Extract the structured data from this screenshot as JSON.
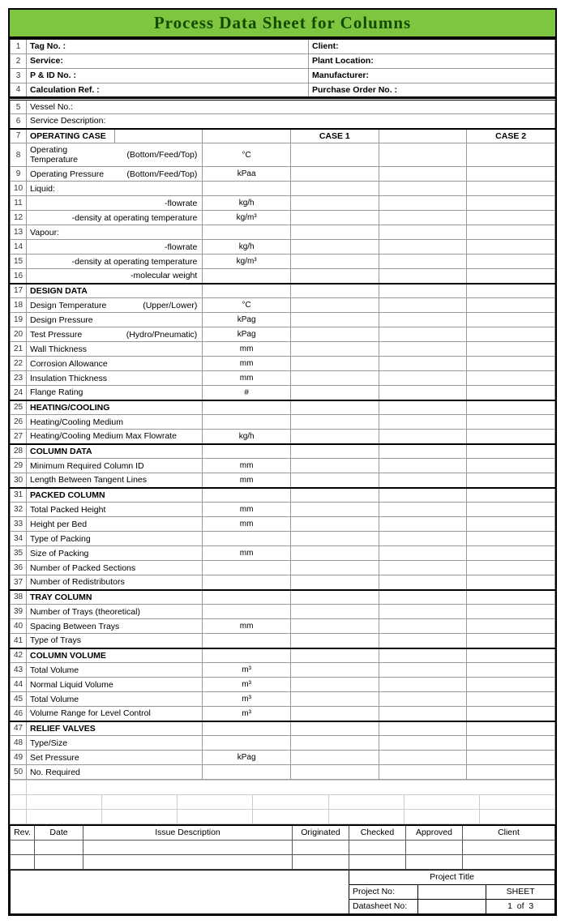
{
  "title": "Process Data Sheet for Columns",
  "header": [
    {
      "n": "1",
      "l": "Tag No. :",
      "r": "Client:"
    },
    {
      "n": "2",
      "l": "Service:",
      "r": "Plant Location:"
    },
    {
      "n": "3",
      "l": "P & ID No. :",
      "r": "Manufacturer:"
    },
    {
      "n": "4",
      "l": "Calculation Ref. :",
      "r": "Purchase Order No. :"
    }
  ],
  "intro": [
    {
      "n": "5",
      "l": "Vessel No.:"
    },
    {
      "n": "6",
      "l": "Service Description:"
    }
  ],
  "opcase": {
    "n": "7",
    "l": "OPERATING CASE",
    "c1": "CASE 1",
    "c2": "CASE 2"
  },
  "rows": [
    {
      "n": "8",
      "l": "Operating Temperature",
      "m": "(Bottom/Feed/Top)",
      "u": "°C"
    },
    {
      "n": "9",
      "l": "Operating Pressure",
      "m": "(Bottom/Feed/Top)",
      "u": "kPaa"
    },
    {
      "n": "10",
      "l": "Liquid:",
      "m": "",
      "u": ""
    },
    {
      "n": "11",
      "l": "",
      "m": "-flowrate",
      "u": "kg/h"
    },
    {
      "n": "12",
      "l": "",
      "m": "-density at operating temperature",
      "u": "kg/m³"
    },
    {
      "n": "13",
      "l": "Vapour:",
      "m": "",
      "u": ""
    },
    {
      "n": "14",
      "l": "",
      "m": "-flowrate",
      "u": "kg/h"
    },
    {
      "n": "15",
      "l": "",
      "m": "-density at operating temperature",
      "u": "kg/m³"
    },
    {
      "n": "16",
      "l": "",
      "m": "-molecular weight",
      "u": ""
    },
    {
      "n": "17",
      "l": "DESIGN DATA",
      "sec": true
    },
    {
      "n": "18",
      "l": "Design Temperature",
      "m": "(Upper/Lower)",
      "u": "°C"
    },
    {
      "n": "19",
      "l": "Design Pressure",
      "m": "",
      "u": "kPag"
    },
    {
      "n": "20",
      "l": "Test Pressure",
      "m": "(Hydro/Pneumatic)",
      "u": "kPag"
    },
    {
      "n": "21",
      "l": "Wall Thickness",
      "m": "",
      "u": "mm"
    },
    {
      "n": "22",
      "l": "Corrosion Allowance",
      "m": "",
      "u": "mm"
    },
    {
      "n": "23",
      "l": "Insulation Thickness",
      "m": "",
      "u": "mm"
    },
    {
      "n": "24",
      "l": "Flange Rating",
      "m": "",
      "u": "#"
    },
    {
      "n": "25",
      "l": "HEATING/COOLING",
      "sec": true
    },
    {
      "n": "26",
      "l": "Heating/Cooling Medium",
      "m": "",
      "u": ""
    },
    {
      "n": "27",
      "l": "Heating/Cooling Medium Max Flowrate",
      "m": "",
      "u": "kg/h"
    },
    {
      "n": "28",
      "l": "COLUMN DATA",
      "sec": true
    },
    {
      "n": "29",
      "l": "Minimum Required Column ID",
      "m": "",
      "u": "mm"
    },
    {
      "n": "30",
      "l": "Length Between Tangent Lines",
      "m": "",
      "u": "mm"
    },
    {
      "n": "31",
      "l": "PACKED COLUMN",
      "sec": true
    },
    {
      "n": "32",
      "l": "Total Packed Height",
      "m": "",
      "u": "mm"
    },
    {
      "n": "33",
      "l": "Height per Bed",
      "m": "",
      "u": "mm"
    },
    {
      "n": "34",
      "l": "Type of Packing",
      "m": "",
      "u": ""
    },
    {
      "n": "35",
      "l": "Size of Packing",
      "m": "",
      "u": "mm"
    },
    {
      "n": "36",
      "l": "Number of Packed Sections",
      "m": "",
      "u": ""
    },
    {
      "n": "37",
      "l": "Number of Redistributors",
      "m": "",
      "u": ""
    },
    {
      "n": "38",
      "l": "TRAY COLUMN",
      "sec": true
    },
    {
      "n": "39",
      "l": "Number of Trays (theoretical)",
      "m": "",
      "u": ""
    },
    {
      "n": "40",
      "l": "Spacing Between Trays",
      "m": "",
      "u": "mm"
    },
    {
      "n": "41",
      "l": "Type of Trays",
      "m": "",
      "u": ""
    },
    {
      "n": "42",
      "l": "COLUMN VOLUME",
      "sec": true
    },
    {
      "n": "43",
      "l": "Total Volume",
      "m": "",
      "u": "m³"
    },
    {
      "n": "44",
      "l": "Normal Liquid Volume",
      "m": "",
      "u": "m³"
    },
    {
      "n": "45",
      "l": "Total Volume",
      "m": "",
      "u": "m³"
    },
    {
      "n": "46",
      "l": "Volume Range for Level Control",
      "m": "",
      "u": "m³"
    },
    {
      "n": "47",
      "l": "RELIEF VALVES",
      "sec": true
    },
    {
      "n": "48",
      "l": "Type/Size",
      "m": "",
      "u": ""
    },
    {
      "n": "49",
      "l": "Set Pressure",
      "m": "",
      "u": "kPag"
    },
    {
      "n": "50",
      "l": "No. Required",
      "m": "",
      "u": ""
    }
  ],
  "rev": {
    "rev": "Rev.",
    "date": "Date",
    "desc": "Issue Description",
    "orig": "Originated",
    "chk": "Checked",
    "app": "Approved",
    "cli": "Client"
  },
  "footer": {
    "pt": "Project Title",
    "pn": "Project No:",
    "ds": "Datasheet No:",
    "sheet": "SHEET",
    "page": "1",
    "of": "of",
    "tot": "3"
  }
}
